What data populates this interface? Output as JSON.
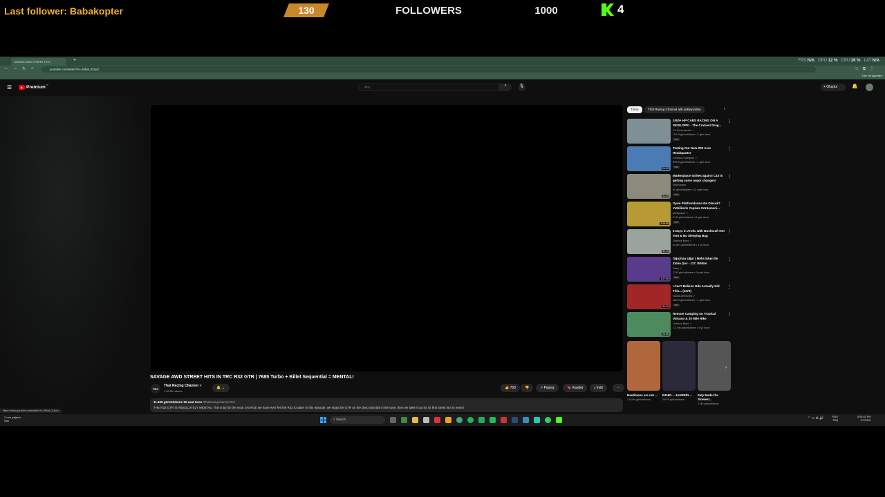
{
  "overlay": {
    "last_follower": "Last follower: Babakopter",
    "count": "130",
    "title": "FOLLOWERS",
    "goal": "1000",
    "kick_count": "4"
  },
  "browser": {
    "tab_title": "SAVAGE AWD STREET HITS",
    "new_tab": "+",
    "perf": {
      "fps_label": "FPS",
      "fps": "N/A",
      "gpu_label": "GPU",
      "gpu": "12 %",
      "cpu_label": "CPU",
      "cpu": "26 %",
      "lat_label": "LAT",
      "lat": "N/A"
    },
    "url": "youtube.com/watch?v=J5lo6_EJy4c",
    "bookmarks": [
      "YouTube",
      "Reddit - Dive into a...",
      "BTCUSDT P 101.551...",
      "ETHUSD 2,371.40 ▲...",
      "USDT.D 5.87% ▼ -2...",
      "NVIDIA Bilançosu - N...",
      "Liquidation Heatma...",
      "55,248.20 | BTCUSD...",
      "The best ChatBot on...",
      "EUR/USD Euro - Do...",
      "US Dollar Index Grat...",
      "CNN International -...",
      "NASDAQ Composit...",
      "YouTube Music",
      "Gidan Kodunu (27.82...",
      "G.E.U. Bilisim Teneki...",
      "Project Zomboid M...",
      "HTML Tutorial",
      "Fetch - Optimizing...",
      "VERAS | Evolve AR",
      "THE BUMPH - Rom..."
    ],
    "all_bookmarks": "Tüm Yer İşaretleri"
  },
  "youtube": {
    "logo": "Premium",
    "logo_sup": "TR",
    "search_placeholder": "Ara",
    "create": "+ Oluştur",
    "video_title": "SAVAGE AWD STREET HITS IN TRC R32 GTR | 7685 Turbo + Billet Sequential = MENTAL!",
    "channel_logo": "TRC",
    "channel_name": "That Racing Channel ✓",
    "subscribers": "1,59 Mn abone",
    "subscribe_bell": "🔔 ⌄",
    "actions": {
      "likes": "👍 750",
      "dislike": "👎",
      "share": "↗ Paylaş",
      "save": "🔖 Kaydet",
      "download": "⤓ İndir",
      "more": "⋯"
    },
    "description": {
      "views": "11.426 görüntüleme  15 saat önce",
      "tag": "#thatracingchannel #trc",
      "text": "THE R32 GTR IS ABSOLUTELY MENTAL! This is by far the most SAVAGE we have ever felt the R32 to date! In this episode, we strap the GTR on the dyno and dial in the tune, then we take it out for its first street hits in years!"
    },
    "chips": [
      "Tümü",
      "That Racing Channel adlı yükleyiciden"
    ],
    "recommendations": [
      {
        "title": "1000+ HP CARS RACING ON A SKISLOPE! - The Craziest Drag...",
        "channel": "Cb Schumacher ✓",
        "views": "751 B görüntüleme • 5 gün önce",
        "badge": "Yeni",
        "duration": "",
        "color": "#7e8f96"
      },
      {
        "title": "Testing Our New 200 Acre Headquarter",
        "channel": "Cleetus Champion ✓",
        "views": "899 B görüntüleme • 2 gün önce",
        "badge": "Yeni",
        "duration": "24:53",
        "color": "#4a7bb5"
      },
      {
        "title": "Marketplace strikes again!! C10 is getting some major changes!",
        "channel": "SillyFargon",
        "views": "82 görüntüleme • 12 saat önce",
        "badge": "Yeni",
        "duration": "21:25",
        "color": "#8c8a7a"
      },
      {
        "title": "Oyun Platformlarına Ne Olacak? Yetkililerle Yapılan Görüşmeni...",
        "channel": "Multiplayer ✓",
        "views": "51 B görüntüleme • 5 gün önce",
        "badge": "Yeni",
        "duration": "1:09:58",
        "color": "#b79a34"
      },
      {
        "title": "3 Days in Arctic with Bushcraft Hot Tent & No Sleeping Bag",
        "channel": "Outdoor Boys ✓",
        "views": "44 Mn görüntüleme • 2 yıl önce",
        "badge": "",
        "duration": "32:15",
        "color": "#9aa39c"
      },
      {
        "title": "Oğuzhan Uğur | Melis İşhen İle Zaten Şov - 127. Bölüm",
        "channel": "Genç ✓",
        "views": "23 B görüntüleme • 9 saat önce",
        "badge": "Yeni",
        "duration": "1:27:39",
        "color": "#5a3a8a"
      },
      {
        "title": "I Can't Believe Oda Actually Did This... (1173)",
        "channel": "StandLifeReview ✓",
        "views": "180 B görüntüleme • 1 gün önce",
        "badge": "Yeni",
        "duration": "31:43",
        "color": "#a32626"
      },
      {
        "title": "Remote Camping on Tropical Volcano & 20 Mile Hike",
        "channel": "Outdoor Boys ✓",
        "views": "1,3 Mn görüntüleme • 4 yıl önce",
        "badge": "",
        "duration": "24:56",
        "color": "#4d8a5e"
      }
    ],
    "shorts": [
      {
        "title": "Nautiluses are not ...",
        "views": "1,9 Mn görüntüleme",
        "color": "#b0683a"
      },
      {
        "title": "EZHEL - JAHREİN ...",
        "views": "240 B görüntüleme",
        "color": "#2a2a3a"
      },
      {
        "title": "Italy Made the Slowest...",
        "views": "2 Mn görüntüleme",
        "color": "#555"
      }
    ],
    "status_url": "https://www.youtube.com/watch?v=J5lo6_EJy4c"
  },
  "taskbar": {
    "weather": "2 mm yağmur",
    "weather_sub": "Salı",
    "search": "Search",
    "tray": "⌃  ▭  ⊕  🔊",
    "lang_top": "ENG",
    "lang_bottom": "TRQ",
    "time": "5:08:43 PM",
    "date": "2/7/2026"
  }
}
